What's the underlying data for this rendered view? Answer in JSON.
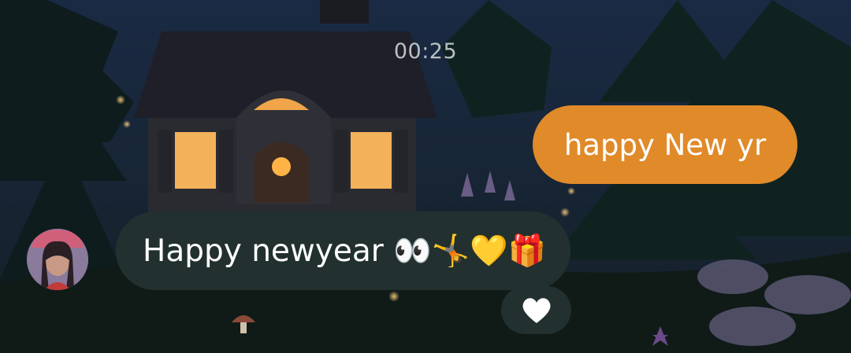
{
  "chat": {
    "timestamp": "00:25",
    "outgoing_message": {
      "text": "happy New yr",
      "color": "#e08a2a"
    },
    "incoming_message": {
      "text": "Happy newyear 👀🤸💛🎁",
      "color": "#22302f"
    },
    "reaction": {
      "icon": "heart-icon",
      "color": "#ffffff"
    },
    "sender_avatar": {
      "icon": "avatar"
    }
  }
}
